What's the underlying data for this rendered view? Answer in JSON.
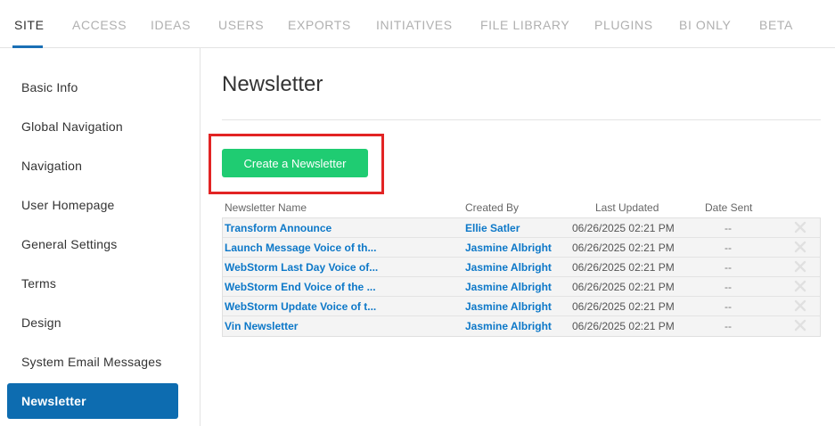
{
  "top_tabs": [
    "SITE",
    "ACCESS",
    "IDEAS",
    "USERS",
    "EXPORTS",
    "INITIATIVES",
    "FILE LIBRARY",
    "PLUGINS",
    "BI ONLY",
    "BETA"
  ],
  "sidebar": {
    "items": [
      "Basic Info",
      "Global Navigation",
      "Navigation",
      "User Homepage",
      "General Settings",
      "Terms",
      "Design",
      "System Email Messages",
      "Newsletter"
    ],
    "active": "Newsletter"
  },
  "page": {
    "title": "Newsletter",
    "create_button": "Create a Newsletter"
  },
  "table": {
    "columns": [
      "Newsletter Name",
      "Created By",
      "Last Updated",
      "Date Sent"
    ],
    "rows": [
      {
        "name": "Transform Announce",
        "created_by": "Ellie Satler",
        "last_updated": "06/26/2025 02:21 PM",
        "date_sent": "--"
      },
      {
        "name": "Launch Message Voice of th...",
        "created_by": "Jasmine Albright",
        "last_updated": "06/26/2025 02:21 PM",
        "date_sent": "--"
      },
      {
        "name": "WebStorm Last Day Voice of...",
        "created_by": "Jasmine Albright",
        "last_updated": "06/26/2025 02:21 PM",
        "date_sent": "--"
      },
      {
        "name": "WebStorm End Voice of the ...",
        "created_by": "Jasmine Albright",
        "last_updated": "06/26/2025 02:21 PM",
        "date_sent": "--"
      },
      {
        "name": "WebStorm Update Voice of t...",
        "created_by": "Jasmine Albright",
        "last_updated": "06/26/2025 02:21 PM",
        "date_sent": "--"
      },
      {
        "name": "Vin Newsletter",
        "created_by": "Jasmine Albright",
        "last_updated": "06/26/2025 02:21 PM",
        "date_sent": "--"
      }
    ],
    "row_action_icon": "delete-x-icon"
  },
  "colors": {
    "active_tab_underline": "#1a6fb5",
    "sidebar_active": "#0d6cb0",
    "create_button": "#1fcc72",
    "link": "#0d78c8",
    "highlight": "#e22424"
  }
}
